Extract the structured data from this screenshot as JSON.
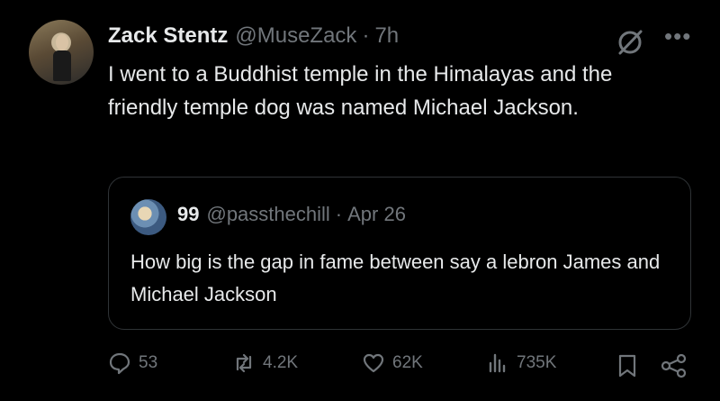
{
  "tweet": {
    "author_name": "Zack Stentz",
    "handle": "@MuseZack",
    "separator": "·",
    "time": "7h",
    "text": "I went to a Buddhist temple in the Himalayas and the friendly temple dog was named Michael Jackson."
  },
  "quoted": {
    "author_name": "99",
    "handle": "@passthechill",
    "separator": "·",
    "date": "Apr 26",
    "text": "How big is the gap in fame between say a lebron James and Michael Jackson"
  },
  "actions": {
    "replies": "53",
    "reposts": "4.2K",
    "likes": "62K",
    "views": "735K"
  },
  "colors": {
    "background": "#000000",
    "text": "#e7e9ea",
    "muted": "#71767b",
    "border": "#2f3336"
  }
}
